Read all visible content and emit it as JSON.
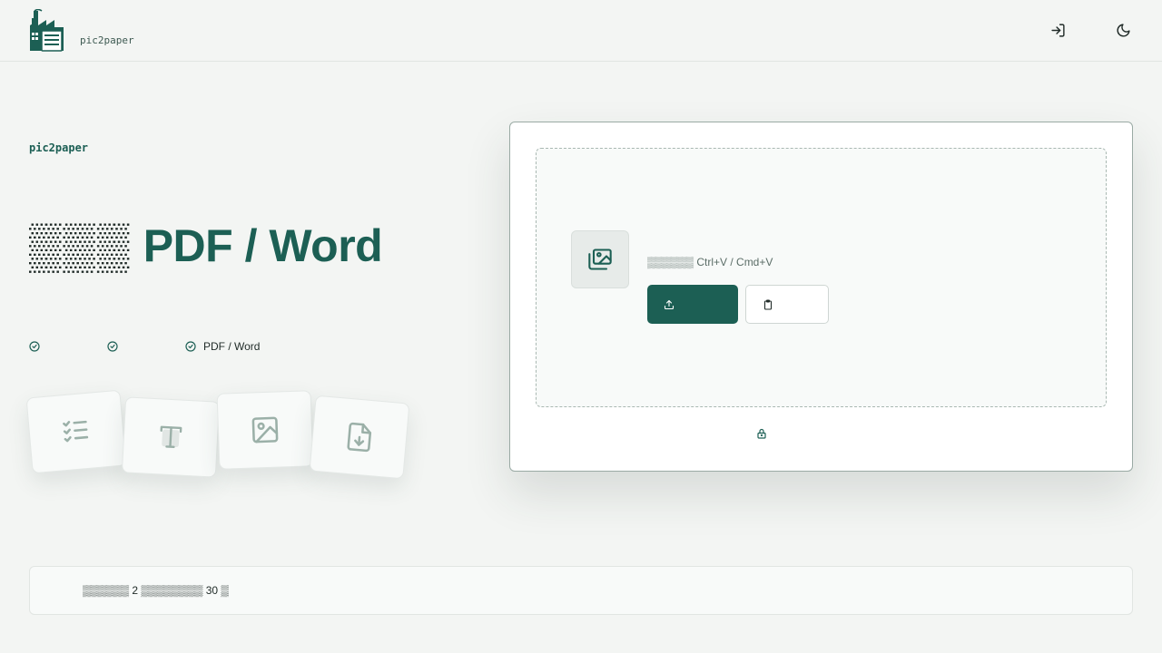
{
  "brand": {
    "name": "pic2paper"
  },
  "hero": {
    "eyebrow": "pic2paper",
    "title_prefix": "▒▒▒",
    "title_suffix": "PDF / Word",
    "features": [
      {
        "label": ""
      },
      {
        "label": ""
      },
      {
        "label": "PDF / Word"
      }
    ]
  },
  "uploader": {
    "hint": "▒▒▒▒▒▒ Ctrl+V / Cmd+V",
    "upload_label": "",
    "paste_label": "",
    "privacy_note": ""
  },
  "notice": {
    "text": "▒▒▒▒▒▒ 2 ▒▒▒▒▒▒▒▒ 30 ▒"
  },
  "colors": {
    "accent": "#1c5f54",
    "background": "#f3f5f3",
    "card": "#ffffff"
  },
  "icons": {
    "header": [
      "login-icon",
      "moon-icon"
    ],
    "tiles": [
      "checklist-icon",
      "text-icon",
      "image-icon",
      "file-download-icon"
    ]
  }
}
